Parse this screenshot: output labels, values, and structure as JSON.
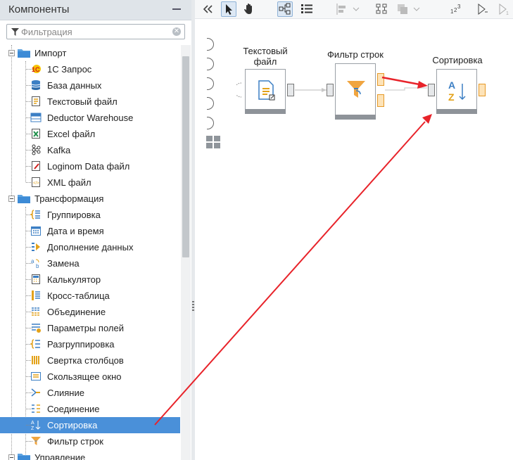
{
  "panel": {
    "title": "Компоненты"
  },
  "filter": {
    "placeholder": "Фильтрация",
    "value": ""
  },
  "tree": {
    "groups": [
      {
        "label": "Импорт",
        "items": [
          "1С Запрос",
          "База данных",
          "Текстовый файл",
          "Deductor Warehouse",
          "Excel файл",
          "Kafka",
          "Loginom Data файл",
          "XML файл"
        ]
      },
      {
        "label": "Трансформация",
        "items": [
          "Группировка",
          "Дата и время",
          "Дополнение данных",
          "Замена",
          "Калькулятор",
          "Кросс-таблица",
          "Объединение",
          "Параметры полей",
          "Разгруппировка",
          "Свертка столбцов",
          "Скользящее окно",
          "Слияние",
          "Соединение",
          "Сортировка",
          "Фильтр строк"
        ]
      },
      {
        "label": "Управление",
        "items": []
      }
    ],
    "selected": "Сортировка"
  },
  "canvas": {
    "nodes": [
      {
        "label_line1": "Текстовый",
        "label_line2": "файл"
      },
      {
        "label_line1": "Фильтр строк"
      },
      {
        "label_line1": "Сортировка"
      }
    ]
  },
  "colors": {
    "accent": "#4a90d9",
    "arrow": "#e8232a",
    "port_out": "#f0a540",
    "header": "#dfe4e9"
  }
}
